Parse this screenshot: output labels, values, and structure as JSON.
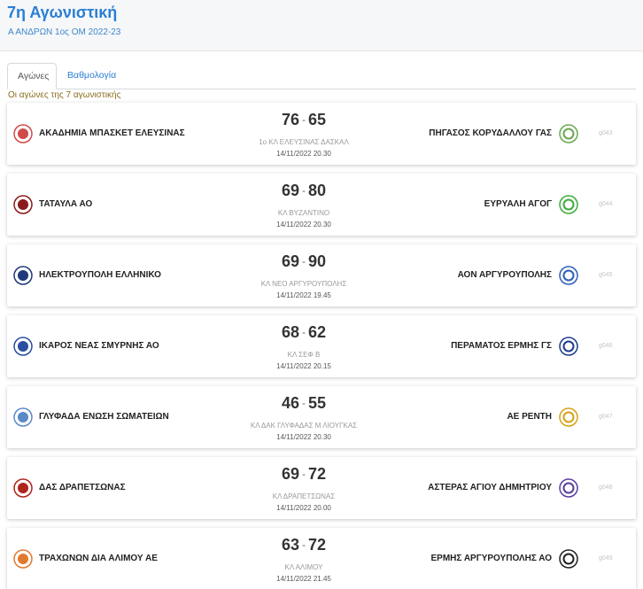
{
  "header": {
    "title": "7η Αγωνιστική",
    "subtitle": "Α ΑΝΔΡΩΝ 1ος ΟΜ 2022-23"
  },
  "tabs": [
    {
      "label": "Αγώνες",
      "active": true
    },
    {
      "label": "Βαθμολογία",
      "active": false
    }
  ],
  "caption": "Οι αγώνες της 7 αγωνιστικής",
  "matches": [
    {
      "home": "ΑΚΑΔΗΜΙΑ ΜΠΑΣΚΕΤ ΕΛΕΥΣΙΝΑΣ",
      "home_score": "76",
      "away_score": "65",
      "separator": "-",
      "away": "ΠΗΓΑΣΟΣ ΚΟΡΥΔΑΛΛΟΥ ΓΑΣ",
      "venue": "1ο ΚΛ ΕΛΕΥΣΙΝΑΣ ΔΑΣΚΑΛ",
      "datetime": "14/11/2022 20.30",
      "code": "g043",
      "home_color": "#d04a4a",
      "away_color": "#6aa84f"
    },
    {
      "home": "ΤΑΤΑΥΛΑ ΑΟ",
      "home_score": "69",
      "away_score": "80",
      "separator": "-",
      "away": "ΕΥΡΥΑΛΗ ΑΓΟΓ",
      "venue": "ΚΛ ΒΥΖΑΝΤΙΝΟ",
      "datetime": "14/11/2022 20.30",
      "code": "g044",
      "home_color": "#8b1a1a",
      "away_color": "#3cab3c"
    },
    {
      "home": "ΗΛΕΚΤΡΟΥΠΟΛΗ ΕΛΛΗΝΙΚΟ",
      "home_score": "69",
      "away_score": "90",
      "separator": "-",
      "away": "ΑΟΝ ΑΡΓΥΡΟΥΠΟΛΗΣ",
      "venue": "ΚΛ ΝΕΟ ΑΡΓΥΡΟΥΠΟΛΗΣ",
      "datetime": "14/11/2022 19.45",
      "code": "g045",
      "home_color": "#1f3a7a",
      "away_color": "#2d5fb8"
    },
    {
      "home": "ΙΚΑΡΟΣ ΝΕΑΣ ΣΜΥΡΝΗΣ ΑΟ",
      "home_score": "68",
      "away_score": "62",
      "separator": "-",
      "away": "ΠΕΡΑΜΑΤΟΣ ΕΡΜΗΣ ΓΣ",
      "venue": "ΚΛ ΣΕΦ Β",
      "datetime": "14/11/2022 20.15",
      "code": "g046",
      "home_color": "#2a4fa0",
      "away_color": "#1d3c8c"
    },
    {
      "home": "ΓΛΥΦΑΔΑ ΕΝΩΣΗ ΣΩΜΑΤΕΙΩΝ",
      "home_score": "46",
      "away_score": "55",
      "separator": "-",
      "away": "ΑΕ ΡΕΝΤΗ",
      "venue": "ΚΛ ΔΑΚ ΓΛΥΦΑΔΑΣ Μ ΛΙΟΥΓΚΑΣ",
      "datetime": "14/11/2022 20.30",
      "code": "g047",
      "home_color": "#5b8ac9",
      "away_color": "#d4a017"
    },
    {
      "home": "ΔΑΣ ΔΡΑΠΕΤΣΩΝΑΣ",
      "home_score": "69",
      "away_score": "72",
      "separator": "-",
      "away": "ΑΣΤΕΡΑΣ ΑΓΙΟΥ ΔΗΜΗΤΡΙΟΥ",
      "venue": "ΚΛ ΔΡΑΠΕΤΣΩΝΑΣ",
      "datetime": "14/11/2022 20.00",
      "code": "g048",
      "home_color": "#b0241c",
      "away_color": "#5b3d9e"
    },
    {
      "home": "ΤΡΑΧΩΝΩΝ ΔΙΑ ΑΛΙΜΟΥ ΑΕ",
      "home_score": "63",
      "away_score": "72",
      "separator": "-",
      "away": "ΕΡΜΗΣ ΑΡΓΥΡΟΥΠΟΛΗΣ ΑΟ",
      "venue": "ΚΛ ΑΛΙΜΟΥ",
      "datetime": "14/11/2022 21.45",
      "code": "g049",
      "home_color": "#e07b2e",
      "away_color": "#222222"
    }
  ],
  "icons": {
    "home_logo": "team-crest-icon",
    "away_logo": "team-crest-icon"
  }
}
